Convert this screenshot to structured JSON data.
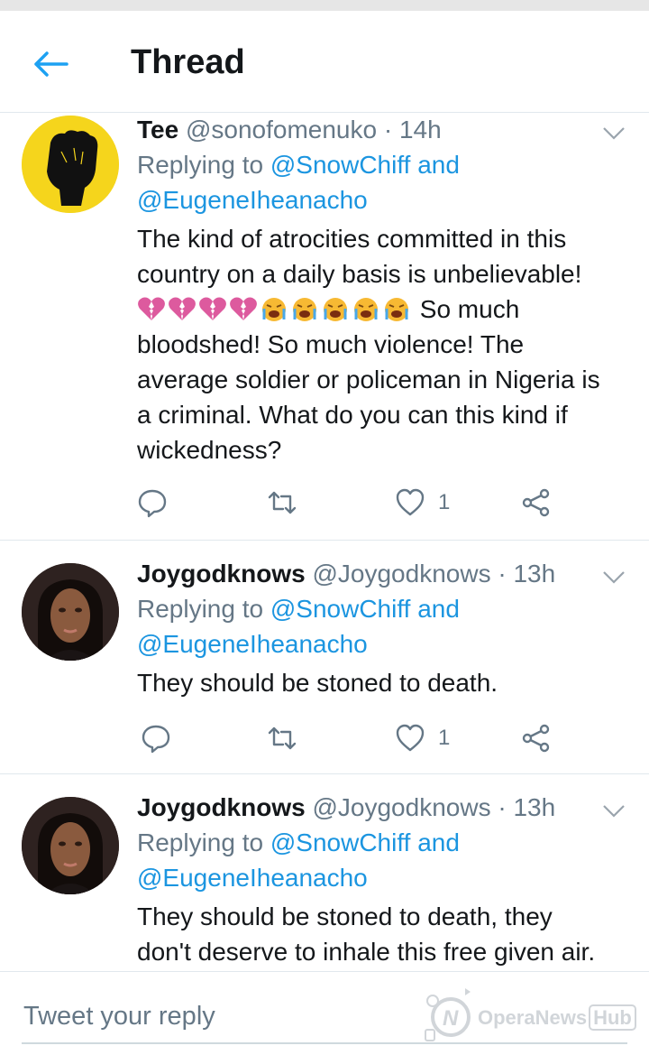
{
  "header": {
    "title": "Thread",
    "back_icon": "arrow-left-icon"
  },
  "tweets": [
    {
      "name": "Tee",
      "handle": "@sonofomenuko",
      "separator": "·",
      "time": "14h",
      "reply_prefix": "Replying to",
      "reply_user1": "@SnowChiff",
      "reply_and": "and",
      "reply_user2": "@EugeneIheanacho",
      "text_lines": [
        "The kind of atrocities committed in this",
        "country on a daily basis is unbelievable!",
        "So much",
        "bloodshed! So much violence! The",
        "average soldier or policeman in Nigeria is",
        "a criminal. What do you can this kind if",
        "wickedness?"
      ],
      "emojis": [
        "broken-heart-emoji",
        "broken-heart-emoji",
        "broken-heart-emoji",
        "broken-heart-emoji",
        "loudly-crying-face-emoji",
        "loudly-crying-face-emoji",
        "loudly-crying-face-emoji",
        "loudly-crying-face-emoji",
        "loudly-crying-face-emoji"
      ],
      "likes": "1"
    },
    {
      "name": "Joygodknows",
      "handle": "@Joygodknows",
      "separator": "·",
      "time": "13h",
      "reply_prefix": "Replying to",
      "reply_user1": "@SnowChiff",
      "reply_and": "and",
      "reply_user2": "@EugeneIheanacho",
      "text_lines": [
        "They should be stoned to death."
      ],
      "likes": "1"
    },
    {
      "name": "Joygodknows",
      "handle": "@Joygodknows",
      "separator": "·",
      "time": "13h",
      "reply_prefix": "Replying to",
      "reply_user1": "@SnowChiff",
      "reply_and": "and",
      "reply_user2": "@EugeneIheanacho",
      "text_lines": [
        "They should be stoned to death, they",
        "don't deserve to inhale this free given air."
      ]
    }
  ],
  "reply_bar": {
    "placeholder": "Tweet your reply"
  },
  "watermark": {
    "brand": "OperaNews",
    "hub": "Hub"
  },
  "colors": {
    "link": "#1b95e0",
    "muted": "#657786",
    "text": "#14171a",
    "accent": "#1da1f2"
  }
}
